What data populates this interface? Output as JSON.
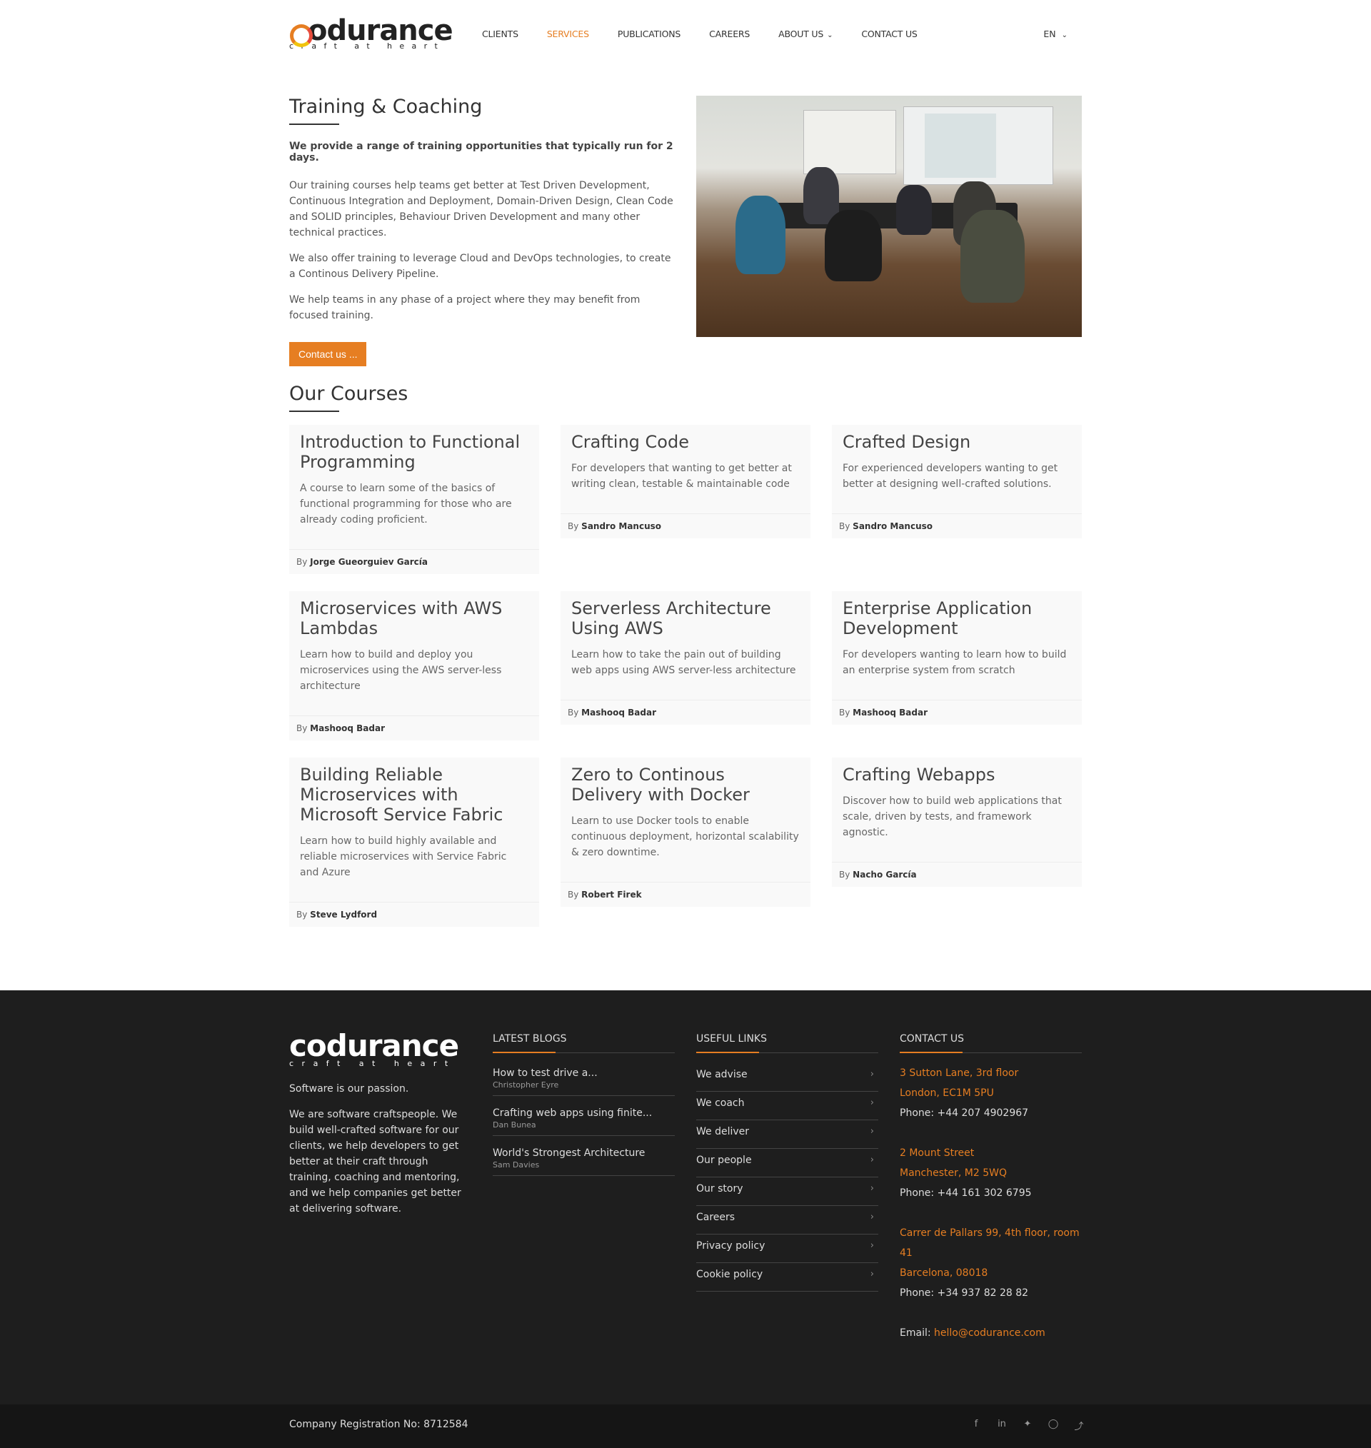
{
  "header": {
    "logo_word": "codurance",
    "logo_tag": "craft at heart",
    "nav": [
      "CLIENTS",
      "SERVICES",
      "PUBLICATIONS",
      "CAREERS",
      "ABOUT US",
      "CONTACT US"
    ],
    "active_nav": "SERVICES",
    "lang": "EN"
  },
  "intro": {
    "title": "Training & Coaching",
    "lead": "We provide a range of training opportunities that typically run for 2 days.",
    "paragraphs": [
      "Our training courses help teams get better at Test Driven Development, Continuous Integration and Deployment, Domain-Driven Design, Clean Code and SOLID principles, Behaviour Driven Development and many other technical practices.",
      "We also offer training to leverage Cloud and DevOps technologies, to create a Continous Delivery Pipeline.",
      "We help teams in any phase of a project where they may benefit from focused training."
    ],
    "button": "Contact us ..."
  },
  "courses": {
    "title": "Our Courses",
    "by_label": "By",
    "items": [
      {
        "title": "Introduction to Functional Programming",
        "desc": "A course to learn some of the basics of functional programming for those who are already coding proficient.",
        "author": "Jorge Gueorguiev García"
      },
      {
        "title": "Crafting Code",
        "desc": "For developers that wanting to get better at writing clean, testable & maintainable code",
        "author": "Sandro Mancuso"
      },
      {
        "title": "Crafted Design",
        "desc": "For experienced developers wanting to get better at designing well-crafted solutions.",
        "author": "Sandro Mancuso"
      },
      {
        "title": "Microservices with AWS Lambdas",
        "desc": "Learn how to build and deploy you microservices using the AWS server-less architecture",
        "author": "Mashooq Badar"
      },
      {
        "title": "Serverless Architecture Using AWS",
        "desc": "Learn how to take the pain out of building web apps using AWS server-less architecture",
        "author": "Mashooq Badar"
      },
      {
        "title": "Enterprise Application Development",
        "desc": "For developers wanting to learn how to build an enterprise system from scratch",
        "author": "Mashooq Badar"
      },
      {
        "title": "Building Reliable Microservices with Microsoft Service Fabric",
        "desc": "Learn how to build highly available and reliable microservices with Service Fabric and Azure",
        "author": "Steve Lydford"
      },
      {
        "title": "Zero to Continous Delivery with Docker",
        "desc": "Learn to use Docker tools to enable continuous deployment, horizontal scalability & zero downtime.",
        "author": "Robert Firek"
      },
      {
        "title": "Crafting Webapps",
        "desc": "Discover how to build web applications that scale, driven by tests, and framework agnostic.",
        "author": "Nacho García"
      }
    ]
  },
  "footer": {
    "logo_word": "codurance",
    "logo_tag": "craft at heart",
    "tagline": "Software is our passion.",
    "about": "We are software craftspeople. We build well-crafted software for our clients, we help developers to get better at their craft through training, coaching and mentoring, and we help companies get better at delivering software.",
    "blogs_title": "LATEST BLOGS",
    "blogs": [
      {
        "title": "How to test drive a...",
        "author": "Christopher Eyre"
      },
      {
        "title": "Crafting web apps using finite...",
        "author": "Dan Bunea"
      },
      {
        "title": "World's Strongest Architecture",
        "author": "Sam Davies"
      }
    ],
    "links_title": "USEFUL LINKS",
    "links": [
      "We advise",
      "We coach",
      "We deliver",
      "Our people",
      "Our story",
      "Careers",
      "Privacy policy",
      "Cookie policy"
    ],
    "contact_title": "CONTACT US",
    "offices": [
      {
        "line1": "3 Sutton Lane, 3rd floor",
        "line2": "London, EC1M 5PU",
        "phone": "Phone: +44 207 4902967"
      },
      {
        "line1": "2 Mount Street",
        "line2": "Manchester, M2 5WQ",
        "phone": "Phone: +44 161 302 6795"
      },
      {
        "line1": "Carrer de Pallars 99, 4th floor, room 41",
        "line2": "Barcelona, 08018",
        "phone": "Phone: +34 937 82 28 82"
      }
    ],
    "email_label": "Email:",
    "email": "hello@codurance.com",
    "registration": "Company Registration No: 8712584",
    "social": [
      "facebook-icon",
      "linkedin-icon",
      "twitter-icon",
      "instagram-icon",
      "rss-icon"
    ]
  },
  "colors": {
    "accent": "#e67e22",
    "footer_bg": "#1e1e1e",
    "bottom_bg": "#151515"
  }
}
